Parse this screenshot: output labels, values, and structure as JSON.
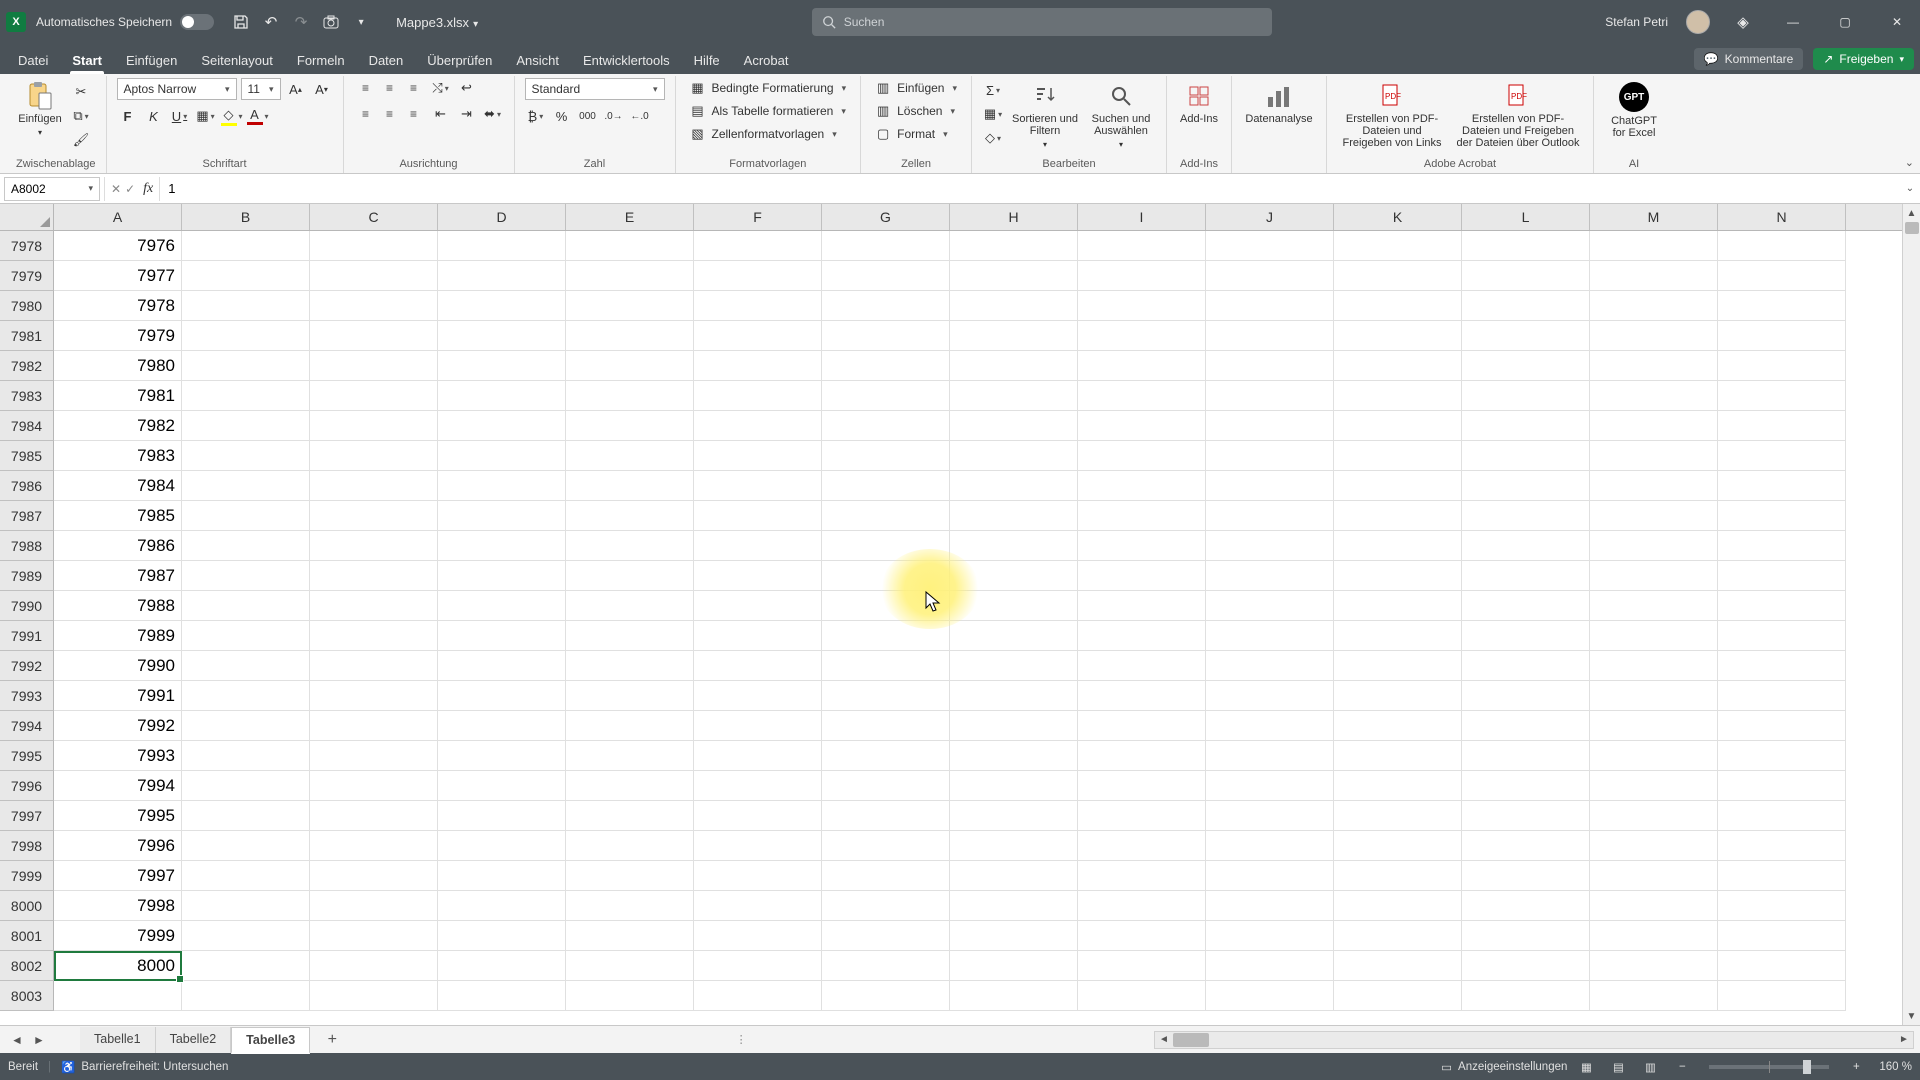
{
  "titlebar": {
    "auto_save": "Automatisches Speichern",
    "file_name": "Mappe3.xlsx",
    "search_placeholder": "Suchen",
    "user_name": "Stefan Petri"
  },
  "tabs": {
    "items": [
      "Datei",
      "Start",
      "Einfügen",
      "Seitenlayout",
      "Formeln",
      "Daten",
      "Überprüfen",
      "Ansicht",
      "Entwicklertools",
      "Hilfe",
      "Acrobat"
    ],
    "active_index": 1,
    "comments": "Kommentare",
    "share": "Freigeben"
  },
  "ribbon": {
    "clipboard": {
      "paste": "Einfügen",
      "group": "Zwischenablage"
    },
    "font": {
      "family": "Aptos Narrow",
      "size": "11",
      "bold": "F",
      "italic": "K",
      "underline": "U",
      "group": "Schriftart",
      "fill_color": "#ffff00",
      "font_color": "#c00000"
    },
    "alignment": {
      "group": "Ausrichtung"
    },
    "number": {
      "format": "Standard",
      "group": "Zahl"
    },
    "styles": {
      "cond_fmt": "Bedingte Formatierung",
      "as_table": "Als Tabelle formatieren",
      "cell_styles": "Zellenformatvorlagen",
      "group": "Formatvorlagen"
    },
    "cells": {
      "insert": "Einfügen",
      "delete": "Löschen",
      "format": "Format",
      "group": "Zellen"
    },
    "editing": {
      "sort": "Sortieren und Filtern",
      "find": "Suchen und Auswählen",
      "group": "Bearbeiten"
    },
    "addins": {
      "label": "Add-Ins",
      "group": "Add-Ins"
    },
    "data_analysis": "Datenanalyse",
    "acrobat": {
      "create_links": "Erstellen von PDF-Dateien und Freigeben von Links",
      "create_outlook": "Erstellen von PDF-Dateien und Freigeben der Dateien über Outlook",
      "group": "Adobe Acrobat"
    },
    "ai": {
      "chatgpt": "ChatGPT for Excel",
      "group": "AI"
    }
  },
  "formula_bar": {
    "name_box": "A8002",
    "formula": "1"
  },
  "grid": {
    "columns": [
      "A",
      "B",
      "C",
      "D",
      "E",
      "F",
      "G",
      "H",
      "I",
      "J",
      "K",
      "L",
      "M",
      "N"
    ],
    "first_row": 7978,
    "row_count": 26,
    "col_a_start_value": 7976,
    "values_in_a_until_row": 8002,
    "active_cell_row": 8002
  },
  "sheets": {
    "tabs": [
      "Tabelle1",
      "Tabelle2",
      "Tabelle3"
    ],
    "active_index": 2
  },
  "status": {
    "ready": "Bereit",
    "accessibility": "Barrierefreiheit: Untersuchen",
    "display_settings": "Anzeigeeinstellungen",
    "zoom": "160 %"
  }
}
